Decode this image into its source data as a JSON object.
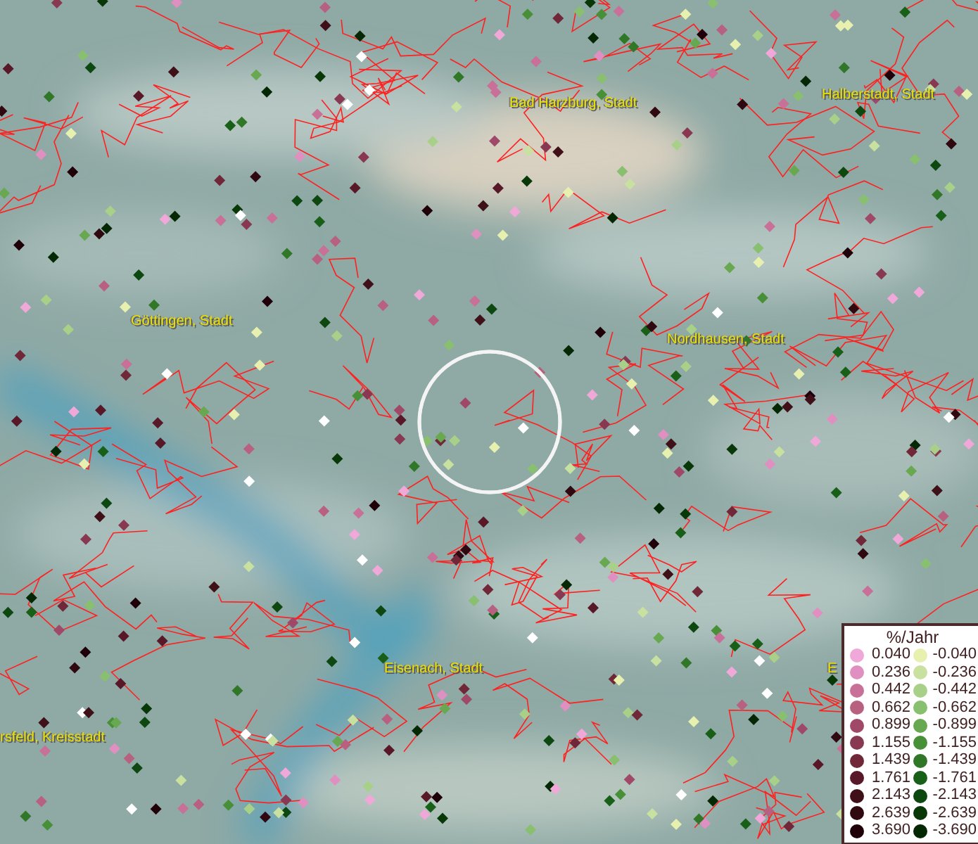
{
  "map": {
    "labels": [
      {
        "text": "Bad Harzburg, Stadt"
      },
      {
        "text": "Halberstadt, Stadt"
      },
      {
        "text": "Göttingen, Stadt"
      },
      {
        "text": "Nordhausen, Stadt"
      },
      {
        "text": "Eisenach, Stadt"
      },
      {
        "text": "rsfeld, Kreisstadt"
      },
      {
        "text": "E"
      }
    ]
  },
  "legend": {
    "title": "%/Jahr",
    "positive": [
      {
        "value": "0.040",
        "color": "#f0a8d8"
      },
      {
        "value": "0.236",
        "color": "#e090c0"
      },
      {
        "value": "0.442",
        "color": "#c87098"
      },
      {
        "value": "0.662",
        "color": "#b86080"
      },
      {
        "value": "0.899",
        "color": "#a04868"
      },
      {
        "value": "1.155",
        "color": "#883850"
      },
      {
        "value": "1.439",
        "color": "#702838"
      },
      {
        "value": "1.761",
        "color": "#581828"
      },
      {
        "value": "2.143",
        "color": "#401018"
      },
      {
        "value": "2.639",
        "color": "#300810"
      },
      {
        "value": "3.690",
        "color": "#200008"
      }
    ],
    "negative": [
      {
        "value": "-0.040",
        "color": "#e8f0b0"
      },
      {
        "value": "-0.236",
        "color": "#c8e0a0"
      },
      {
        "value": "-0.442",
        "color": "#a8d088"
      },
      {
        "value": "-0.662",
        "color": "#88c070"
      },
      {
        "value": "-0.899",
        "color": "#68a850"
      },
      {
        "value": "-1.155",
        "color": "#489038"
      },
      {
        "value": "-1.439",
        "color": "#307828"
      },
      {
        "value": "-1.761",
        "color": "#186018"
      },
      {
        "value": "-2.143",
        "color": "#0c4810"
      },
      {
        "value": "-2.639",
        "color": "#083808"
      },
      {
        "value": "-3.690",
        "color": "#042804"
      }
    ]
  }
}
